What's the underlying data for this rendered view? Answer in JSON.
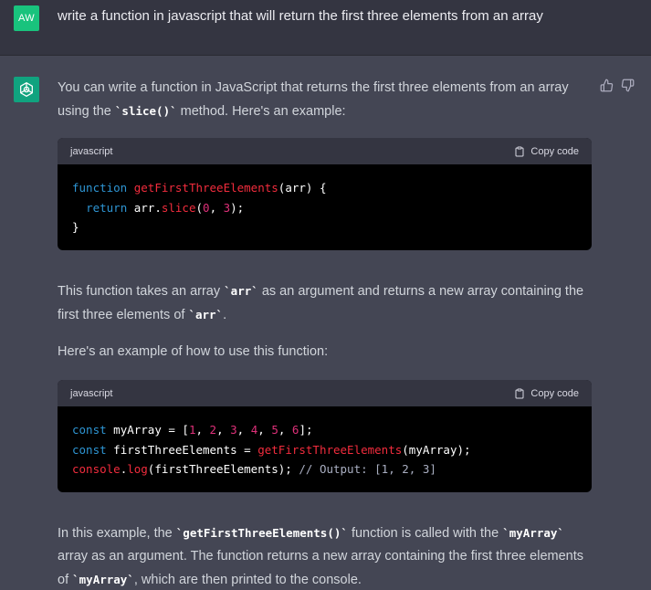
{
  "user": {
    "avatar_initials": "AW",
    "message": "write a function in javascript that will return the first three elements from an array"
  },
  "assistant": {
    "avatar_icon": "openai-logo-icon",
    "p1_before": "You can write a function in JavaScript that returns the first three elements from an array using the ",
    "p1_code": "`slice()`",
    "p1_after": " method. Here's an example:",
    "p2_before": "This function takes an array ",
    "p2_code1": "`arr`",
    "p2_mid": " as an argument and returns a new array containing the first three elements of ",
    "p2_code2": "`arr`",
    "p2_after": ".",
    "p3": "Here's an example of how to use this function:",
    "p4_a": "In this example, the ",
    "p4_code1": "`getFirstThreeElements()`",
    "p4_b": " function is called with the ",
    "p4_code2": "`myArray`",
    "p4_c": " array as an argument. The function returns a new array containing the first three elements of ",
    "p4_code3": "`myArray`",
    "p4_d": ", which are then printed to the console."
  },
  "code_blocks": [
    {
      "language": "javascript",
      "copy_label": "Copy code",
      "lines": [
        [
          {
            "t": "function",
            "c": "kw"
          },
          {
            "t": " "
          },
          {
            "t": "getFirstThreeElements",
            "c": "fn"
          },
          {
            "t": "(arr) {"
          }
        ],
        [
          {
            "t": "  "
          },
          {
            "t": "return",
            "c": "kw"
          },
          {
            "t": " arr."
          },
          {
            "t": "slice",
            "c": "fn"
          },
          {
            "t": "("
          },
          {
            "t": "0",
            "c": "num"
          },
          {
            "t": ", "
          },
          {
            "t": "3",
            "c": "num"
          },
          {
            "t": ");"
          }
        ],
        [
          {
            "t": "}"
          }
        ]
      ]
    },
    {
      "language": "javascript",
      "copy_label": "Copy code",
      "lines": [
        [
          {
            "t": "const",
            "c": "kw"
          },
          {
            "t": " myArray = ["
          },
          {
            "t": "1",
            "c": "num"
          },
          {
            "t": ", "
          },
          {
            "t": "2",
            "c": "num"
          },
          {
            "t": ", "
          },
          {
            "t": "3",
            "c": "num"
          },
          {
            "t": ", "
          },
          {
            "t": "4",
            "c": "num"
          },
          {
            "t": ", "
          },
          {
            "t": "5",
            "c": "num"
          },
          {
            "t": ", "
          },
          {
            "t": "6",
            "c": "num"
          },
          {
            "t": "];"
          }
        ],
        [
          {
            "t": "const",
            "c": "kw"
          },
          {
            "t": " firstThreeElements = "
          },
          {
            "t": "getFirstThreeElements",
            "c": "fn"
          },
          {
            "t": "(myArray);"
          }
        ],
        [
          {
            "t": "console",
            "c": "fn"
          },
          {
            "t": "."
          },
          {
            "t": "log",
            "c": "fn"
          },
          {
            "t": "(firstThreeElements); "
          },
          {
            "t": "// Output: [1, 2, 3]",
            "c": "cm"
          }
        ]
      ]
    }
  ],
  "colors": {
    "page_bg": "#444654",
    "user_row_bg": "#343541",
    "user_avatar": "#19c37d",
    "assistant_avatar": "#10a37f",
    "code_bg": "#000000",
    "keyword": "#2e95d3",
    "function": "#f22c3d",
    "number": "#df3079",
    "comment": "#a9aec1"
  },
  "icons": {
    "thumbs_up": "thumbs-up-icon",
    "thumbs_down": "thumbs-down-icon",
    "clipboard": "clipboard-icon"
  }
}
